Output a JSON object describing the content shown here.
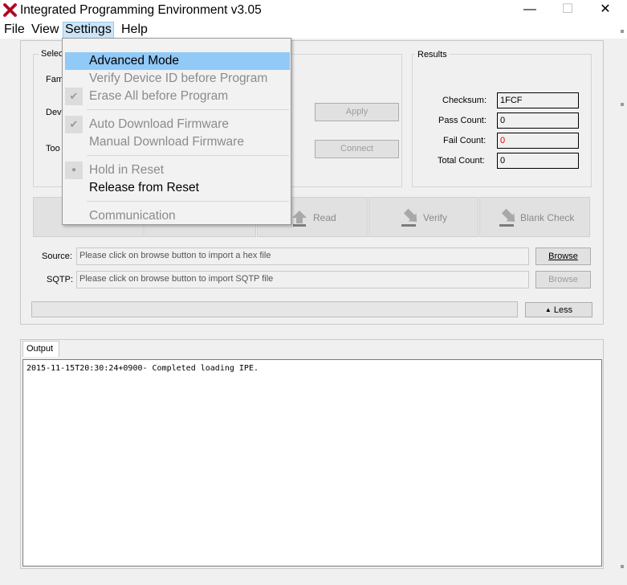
{
  "window": {
    "title": "Integrated Programming Environment v3.05",
    "minimize": "—",
    "maximize": "☐",
    "close": "✕"
  },
  "menubar": {
    "file": "File",
    "view": "View",
    "settings": "Settings",
    "help": "Help"
  },
  "settings_menu": {
    "items": [
      {
        "label": "Advanced Mode",
        "checked": false,
        "enabled": true,
        "highlighted": true
      },
      {
        "label": "Verify Device ID before Program",
        "checked": false,
        "enabled": false
      },
      {
        "label": "Erase All before Program",
        "checked": true,
        "enabled": false
      },
      {
        "label": "Auto Download Firmware",
        "checked": true,
        "enabled": false
      },
      {
        "label": "Manual Download Firmware",
        "checked": false,
        "enabled": false
      },
      {
        "label": "Hold in Reset",
        "checked": true,
        "enabled": false
      },
      {
        "label": "Release from Reset",
        "checked": false,
        "enabled": true
      },
      {
        "label": "Communication",
        "checked": false,
        "enabled": false
      }
    ]
  },
  "device_panel": {
    "title_partial": "Selec",
    "family_partial": "Fam",
    "device_partial": "Dev",
    "tool_partial": "Too",
    "apply": "Apply",
    "connect": "Connect"
  },
  "results": {
    "title": "Results",
    "checksum_label": "Checksum:",
    "checksum_value": "1FCF",
    "pass_label": "Pass Count:",
    "pass_value": "0",
    "fail_label": "Fail Count:",
    "fail_value": "0",
    "total_label": "Total Count:",
    "total_value": "0",
    "fail_color": "#e00000"
  },
  "actions": {
    "read": "Read",
    "verify": "Verify",
    "blank_check": "Blank Check"
  },
  "source": {
    "label": "Source:",
    "placeholder": "Please click on browse button to import a hex file",
    "browse": "Browse"
  },
  "sqtp": {
    "label": "SQTP:",
    "placeholder": "Please click on browse button to import SQTP file",
    "browse": "Browse"
  },
  "less_button": "Less",
  "output": {
    "tab": "Output",
    "log": "2015-11-15T20:30:24+0900- Completed loading IPE."
  },
  "colors": {
    "highlight": "#91c9f7",
    "menu_active": "#cce4f7",
    "app_icon": "#c8102e"
  }
}
